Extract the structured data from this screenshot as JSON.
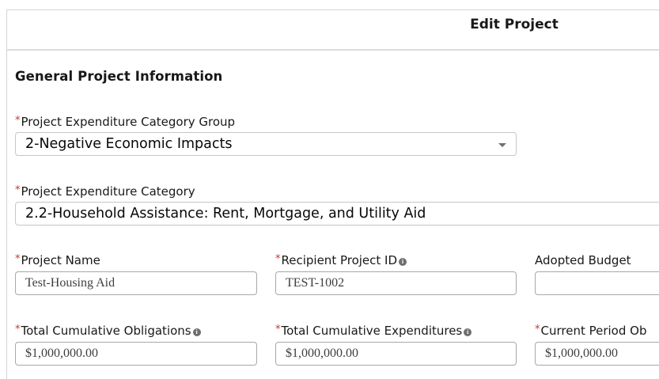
{
  "modal": {
    "title": "Edit Project"
  },
  "section": {
    "title": "General Project Information"
  },
  "fields": {
    "category_group": {
      "label": "Project Expenditure Category Group",
      "value": "2-Negative Economic Impacts"
    },
    "category": {
      "label": "Project Expenditure Category",
      "value": "2.2-Household Assistance: Rent, Mortgage, and Utility Aid"
    },
    "project_name": {
      "label": "Project Name",
      "value": "Test-Housing Aid"
    },
    "recipient_project_id": {
      "label": "Recipient Project ID",
      "value": "TEST-1002"
    },
    "adopted_budget": {
      "label": "Adopted Budget",
      "value": ""
    },
    "total_cumulative_obligations": {
      "label": "Total Cumulative Obligations",
      "value": "$1,000,000.00"
    },
    "total_cumulative_expenditures": {
      "label": "Total Cumulative Expenditures",
      "value": "$1,000,000.00"
    },
    "current_period_obligations": {
      "label": "Current Period Ob",
      "value": "$1,000,000.00"
    }
  },
  "required_marker": "*",
  "info_icon_glyph": "i",
  "colors": {
    "required": "#c23934",
    "border": "#c9c7c5",
    "info_icon": "#706e6b"
  }
}
